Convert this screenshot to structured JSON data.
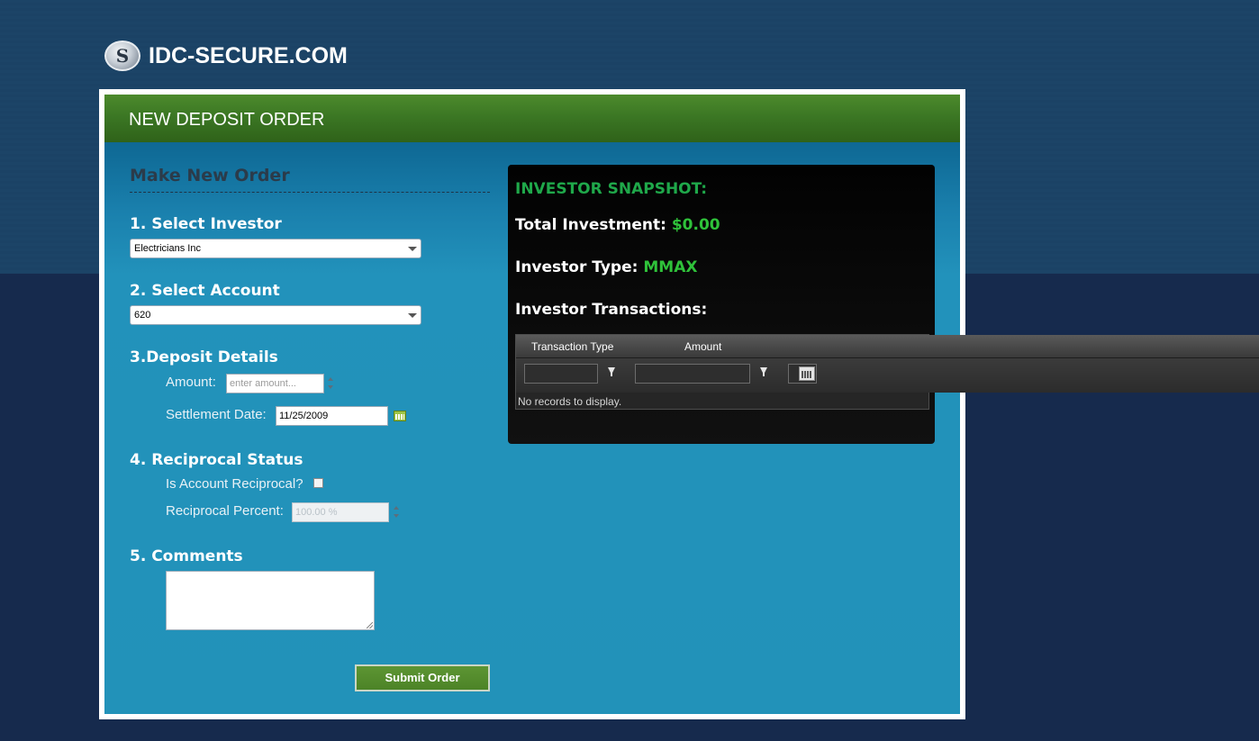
{
  "site": {
    "logo_text": "IDC-SECURE.COM",
    "logo_icon": "idc-logo-icon"
  },
  "panel": {
    "title": "NEW DEPOSIT ORDER"
  },
  "form": {
    "heading": "Make New Order",
    "step1_label": "1. Select Investor",
    "investor_value": "Electricians Inc",
    "step2_label": "2. Select Account",
    "account_value": "620",
    "step3_label": "3.Deposit Details",
    "amount_label": "Amount:",
    "amount_placeholder": "enter amount...",
    "settlement_label": "Settlement Date:",
    "settlement_value": "11/25/2009",
    "step4_label": "4. Reciprocal Status",
    "reciprocal_question": "Is Account Reciprocal?",
    "reciprocal_checked": false,
    "reciprocal_percent_label": "Reciprocal Percent:",
    "reciprocal_percent_value": "100.00 %",
    "step5_label": "5. Comments",
    "comments_value": "",
    "submit_label": "Submit Order"
  },
  "snapshot": {
    "title": "INVESTOR SNAPSHOT:",
    "total_investment_label": "Total Investment:",
    "total_investment_value": "$0.00",
    "investor_type_label": "Investor Type:",
    "investor_type_value": "MMAX",
    "transactions_label": "Investor Transactions:",
    "grid": {
      "columns": [
        "Transaction Type",
        "Amount"
      ],
      "empty_message": "No records to display."
    }
  },
  "colors": {
    "page_bg": "#162a4d",
    "header_green": "#3a7523",
    "panel_blue": "#2292b9",
    "snapshot_accent": "#2fc23a"
  }
}
